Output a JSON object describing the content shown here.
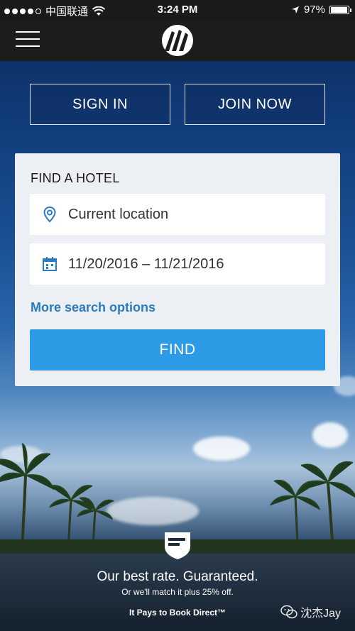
{
  "status_bar": {
    "carrier": "中国联通",
    "time": "3:24 PM",
    "battery": "97%",
    "battery_level": 0.97
  },
  "nav": {
    "menu_icon": "hamburger-menu-icon",
    "logo_icon": "marriott-logo-icon"
  },
  "auth": {
    "sign_in_label": "SIGN IN",
    "join_now_label": "JOIN NOW"
  },
  "find_hotel": {
    "title": "FIND A HOTEL",
    "location_value": "Current location",
    "location_icon": "location-pin-icon",
    "dates_value": "11/20/2016 – 11/21/2016",
    "dates_icon": "calendar-icon",
    "more_options_label": "More search options",
    "find_label": "FIND"
  },
  "promo": {
    "headline": "Our best rate. Guaranteed.",
    "subline": "Or we'll match it plus 25% off.",
    "tagline": "It Pays to Book Direct™",
    "icon": "rate-guarantee-shield-icon"
  },
  "watermark": {
    "text": "沈杰Jay",
    "icon": "wechat-icon"
  },
  "colors": {
    "accent": "#2d9ae6",
    "link": "#2b7bbf",
    "navbar": "#1c1c1c"
  }
}
